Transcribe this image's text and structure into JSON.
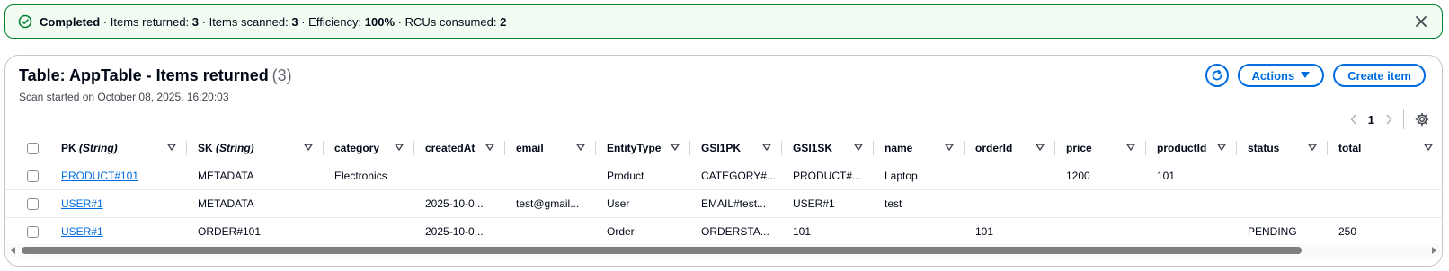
{
  "flash": {
    "status": "Completed",
    "sep": " · ",
    "items_returned_label": "Items returned: ",
    "items_returned": "3",
    "items_scanned_label": "Items scanned: ",
    "items_scanned": "3",
    "efficiency_label": "Efficiency: ",
    "efficiency": "100%",
    "rcus_label": "RCUs consumed: ",
    "rcus": "2",
    "icon": "check-circle-icon",
    "close_icon": "close-icon",
    "color": "#00802f"
  },
  "panel": {
    "title": "Table: AppTable - Items returned",
    "count": "(3)",
    "subtitle": "Scan started on October 08, 2025, 16:20:03",
    "actions_label": "Actions",
    "create_label": "Create item",
    "refresh_icon": "refresh-icon"
  },
  "pagination": {
    "page": "1"
  },
  "columns": [
    {
      "label": "PK ",
      "type": "(String)"
    },
    {
      "label": "SK ",
      "type": "(String)"
    },
    {
      "label": "category",
      "type": ""
    },
    {
      "label": "createdAt",
      "type": ""
    },
    {
      "label": "email",
      "type": ""
    },
    {
      "label": "EntityType",
      "type": ""
    },
    {
      "label": "GSI1PK",
      "type": ""
    },
    {
      "label": "GSI1SK",
      "type": ""
    },
    {
      "label": "name",
      "type": ""
    },
    {
      "label": "orderId",
      "type": ""
    },
    {
      "label": "price",
      "type": ""
    },
    {
      "label": "productId",
      "type": ""
    },
    {
      "label": "status",
      "type": ""
    },
    {
      "label": "total",
      "type": ""
    }
  ],
  "rows": [
    [
      "PRODUCT#101",
      "METADATA",
      "Electronics",
      "",
      "",
      "Product",
      "CATEGORY#...",
      "PRODUCT#...",
      "Laptop",
      "",
      "1200",
      "101",
      "",
      ""
    ],
    [
      "USER#1",
      "METADATA",
      "",
      "2025-10-0...",
      "test@gmail...",
      "User",
      "EMAIL#test...",
      "USER#1",
      "test",
      "",
      "",
      "",
      "",
      ""
    ],
    [
      "USER#1",
      "ORDER#101",
      "",
      "2025-10-0...",
      "",
      "Order",
      "ORDERSTA...",
      "101",
      "",
      "101",
      "",
      "",
      "PENDING",
      "250"
    ]
  ],
  "colors": {
    "accent": "#006ce0",
    "success": "#00802f"
  }
}
